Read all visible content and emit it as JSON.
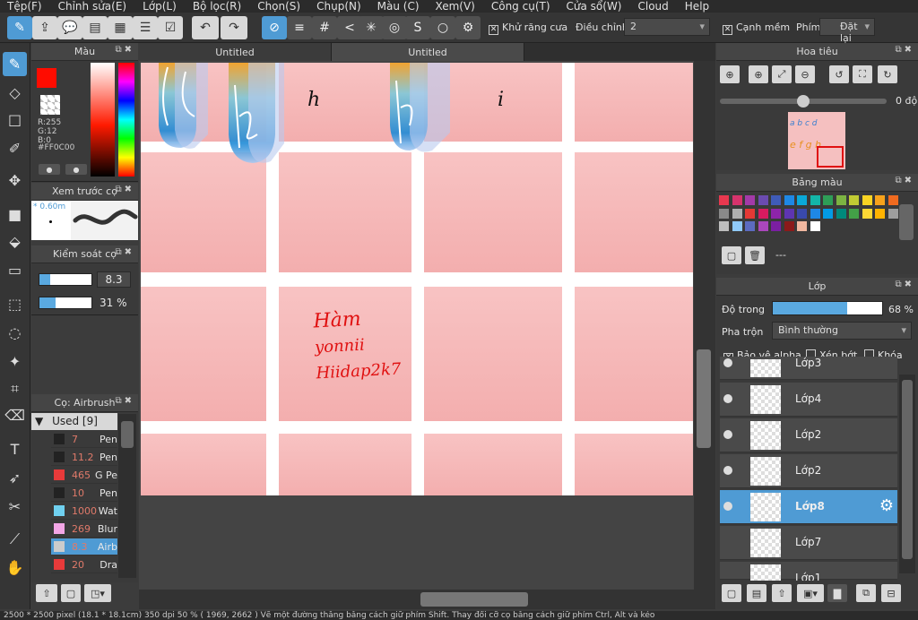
{
  "menu": [
    "Tệp(F)",
    "Chỉnh sửa(E)",
    "Lớp(L)",
    "Bộ lọc(R)",
    "Chọn(S)",
    "Chụp(N)",
    "Màu (C)",
    "Xem(V)",
    "Công cụ(T)",
    "Cửa sổ(W)",
    "Cloud",
    "Help"
  ],
  "toolbar": {
    "antialias": "Khử răng cưa",
    "adjust_label": "Điều chỉnh",
    "adjust_value": "2",
    "edge": "Cạnh mềm",
    "key_label": "Phím",
    "reset": "Đặt lại"
  },
  "tabs": [
    "Untitled",
    "Untitled"
  ],
  "color_panel": {
    "title": "Màu",
    "r": "R:255",
    "g": "G:12",
    "b": "B:0",
    "hex": "#FF0C00"
  },
  "brush_preview": {
    "title": "Xem trước cọ",
    "size": "* 0.60m"
  },
  "brush_control": {
    "title": "Kiểm soát cọ",
    "size": "8.3",
    "opacity": "31 %",
    "size_fraction": 0.2,
    "opacity_fraction": 0.31
  },
  "brush_list": {
    "title": "Cọ: Airbrush",
    "group": "Used [9]",
    "items": [
      {
        "value": "7",
        "name": "Pen",
        "color": "#222222"
      },
      {
        "value": "11.2",
        "name": "Pen",
        "color": "#222222"
      },
      {
        "value": "465",
        "name": "G Pe",
        "color": "#e83a3a"
      },
      {
        "value": "10",
        "name": "Pen",
        "color": "#222222"
      },
      {
        "value": "1000",
        "name": "Wat",
        "color": "#6fd0ef"
      },
      {
        "value": "269",
        "name": "Blur",
        "color": "#f3a6e6"
      },
      {
        "value": "8.3",
        "name": "Airb",
        "color": "#cccccc",
        "selected": true
      },
      {
        "value": "20",
        "name": "Dra",
        "color": "#e83a3a"
      }
    ]
  },
  "navigator": {
    "title": "Hoa tiêu",
    "angle": "0 độ"
  },
  "palette": {
    "title": "Bảng màu",
    "name": "---",
    "colors": [
      "#e8384f",
      "#d6336c",
      "#a33aa8",
      "#6b4bb0",
      "#3f5bb8",
      "#1e88e5",
      "#0aa8d8",
      "#13b5a8",
      "#2e9e57",
      "#7cb342",
      "#c0ca33",
      "#f9d423",
      "#f7a21b",
      "#f06a1f",
      "#8a8a8a",
      "#b0b0b0",
      "#e53935",
      "#d81b60",
      "#8e24aa",
      "#5e35b1",
      "#3949ab",
      "#1e88e5",
      "#039be5",
      "#00897b",
      "#43a047",
      "#fdd835",
      "#ffb300",
      "#9e9e9e",
      "#bdbdbd",
      "#90caf9",
      "#5c6bc0",
      "#ab47bc",
      "#7b1fa2",
      "#8b1a1a",
      "#f2b8a0",
      "#ffffff"
    ]
  },
  "layers": {
    "title": "Lớp",
    "opacity_label": "Độ trong",
    "opacity": "68 %",
    "opacity_fraction": 0.68,
    "blend_label": "Pha trộn",
    "blend": "Bình thường",
    "protect": "Bảo vệ alpha",
    "clip": "Xén bớt",
    "lock": "Khóa",
    "items": [
      {
        "name": "Lớp3"
      },
      {
        "name": "Lớp4"
      },
      {
        "name": "Lớp2"
      },
      {
        "name": "Lớp2"
      },
      {
        "name": "Lớp8",
        "selected": true
      },
      {
        "name": "Lớp7"
      },
      {
        "name": "Lớp1"
      }
    ]
  },
  "canvas_text": [
    "Hàm",
    "yonnii",
    "Hiidap2k7"
  ],
  "status": "2500 * 2500 pixel  (18.1 * 18.1cm)  350 dpi  50 %  ( 1969, 2662 )  Vẽ một đường thẳng bằng cách giữ phím Shift. Thay đổi cỡ cọ bằng cách giữ phím Ctrl, Alt và kéo"
}
